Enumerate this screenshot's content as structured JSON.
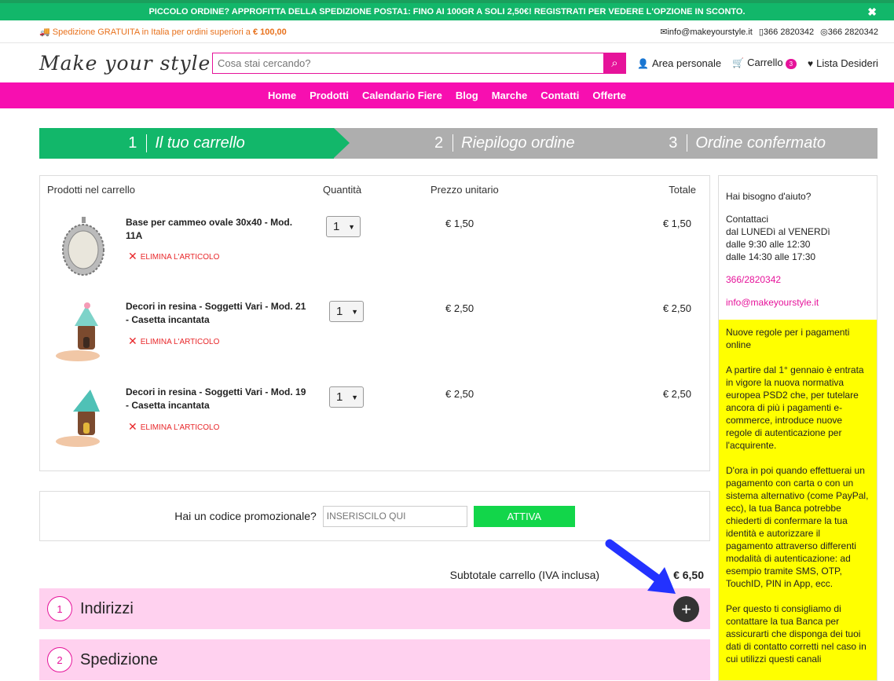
{
  "topbar": {
    "promo": "PICCOLO ORDINE? APPROFITTA DELLA SPEDIZIONE POSTA1: FINO AI 100GR A SOLI 2,50€! REGISTRATI PER VEDERE L'OPZIONE IN SCONTO.",
    "close": "✖"
  },
  "infobar": {
    "shipping": "Spedizione GRATUITA in Italia per ordini superiori a",
    "shipping_amount": "€ 100,00",
    "email": "info@makeyourstyle.it",
    "phone": "366 2820342",
    "whatsapp": "366 2820342"
  },
  "header": {
    "logo": "Make your style",
    "search_placeholder": "Cosa stai cercando?",
    "account": "Area personale",
    "cart": "Carrello",
    "cart_count": "3",
    "wishlist": "Lista Desideri"
  },
  "nav": [
    "Home",
    "Prodotti",
    "Calendario Fiere",
    "Blog",
    "Marche",
    "Contatti",
    "Offerte"
  ],
  "steps": [
    {
      "num": "1",
      "label": "Il tuo carrello"
    },
    {
      "num": "2",
      "label": "Riepilogo ordine"
    },
    {
      "num": "3",
      "label": "Ordine confermato"
    }
  ],
  "cart": {
    "headers": {
      "products": "Prodotti nel carrello",
      "qty": "Quantità",
      "unit": "Prezzo unitario",
      "total": "Totale"
    },
    "delete_label": "ELIMINA L'ARTICOLO",
    "items": [
      {
        "name": "Base per cammeo ovale 30x40 - Mod. 11A",
        "qty": "1",
        "unit": "€ 1,50",
        "total": "€ 1,50"
      },
      {
        "name": "Decori in resina - Soggetti Vari - Mod. 21 - Casetta incantata",
        "qty": "1",
        "unit": "€ 2,50",
        "total": "€ 2,50"
      },
      {
        "name": "Decori in resina - Soggetti Vari - Mod. 19 - Casetta incantata",
        "qty": "1",
        "unit": "€ 2,50",
        "total": "€ 2,50"
      }
    ]
  },
  "promo": {
    "label": "Hai un codice promozionale?",
    "placeholder": "INSERISCILO QUI",
    "button": "ATTIVA"
  },
  "subtotal": {
    "label": "Subtotale carrello (IVA inclusa)",
    "value": "€ 6,50"
  },
  "accordion": [
    {
      "num": "1",
      "label": "Indirizzi"
    },
    {
      "num": "2",
      "label": "Spedizione"
    }
  ],
  "sidebar": {
    "help_title": "Hai bisogno d'aiuto?",
    "contact_1": "Contattaci",
    "contact_2": "dal LUNEDì al VENERDì",
    "contact_3": "dalle 9:30 alle 12:30",
    "contact_4": "dalle 14:30 alle 17:30",
    "phone": "366/2820342",
    "email": "info@makeyourstyle.it",
    "notice_title": "Nuove regole per i pagamenti online",
    "notice_p1": "A partire dal 1° gennaio è entrata in vigore la nuova normativa europea PSD2 che, per tutelare ancora di più i pagamenti e-commerce, introduce nuove regole di autenticazione per l'acquirente.",
    "notice_p2": "D'ora in poi quando effettuerai un pagamento con carta o con un sistema alternativo (come PayPal, ecc), la tua Banca potrebbe chiederti di confermare la tua identità e autorizzare il pagamento attraverso differenti modalità di autenticazione: ad esempio tramite SMS, OTP, TouchID, PIN in App, ecc.",
    "notice_p3": "Per questo ti consigliamo di contattare la tua Banca per assicurarti che disponga dei tuoi dati di contatto corretti nel caso in cui utilizzi questi canali"
  }
}
